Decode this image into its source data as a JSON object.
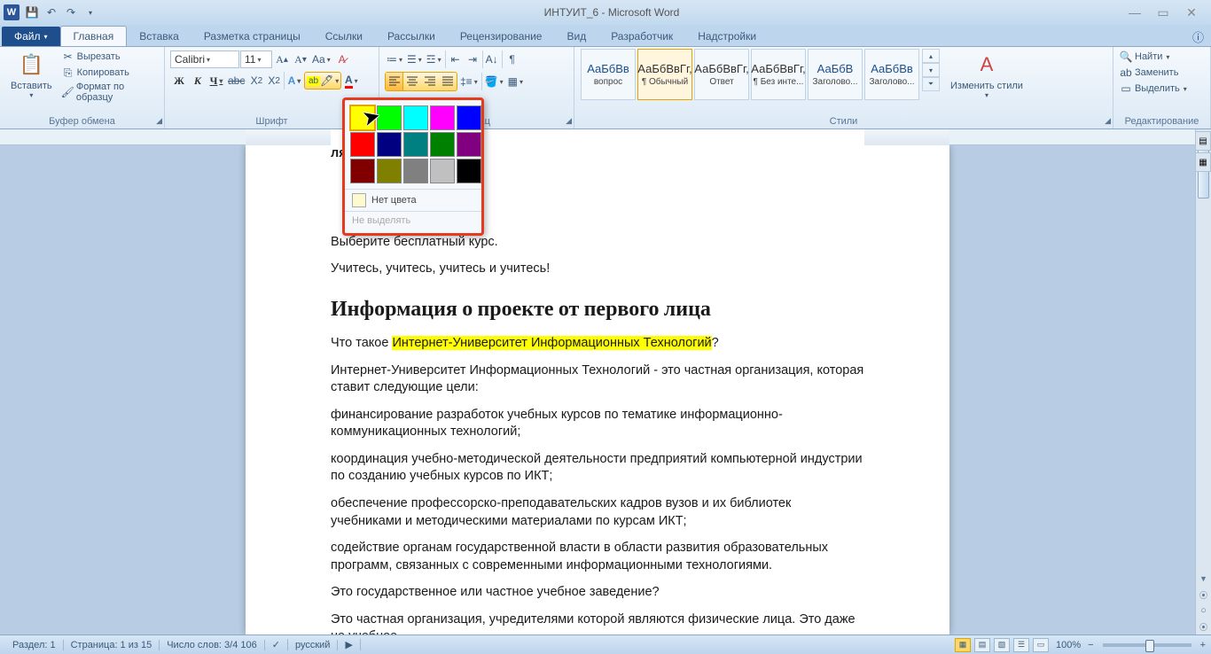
{
  "title": "ИНТУИТ_6 - Microsoft Word",
  "tabs": {
    "file": "Файл",
    "items": [
      "Главная",
      "Вставка",
      "Разметка страницы",
      "Ссылки",
      "Рассылки",
      "Рецензирование",
      "Вид",
      "Разработчик",
      "Надстройки"
    ],
    "active": 0
  },
  "clipboard": {
    "paste": "Вставить",
    "cut": "Вырезать",
    "copy": "Копировать",
    "format_painter": "Формат по образцу",
    "label": "Буфер обмена"
  },
  "font": {
    "name": "Calibri",
    "size": "11",
    "label": "Шрифт"
  },
  "paragraph": {
    "label": "Абзац"
  },
  "styles": {
    "label": "Стили",
    "change": "Изменить стили",
    "items": [
      {
        "preview": "АаБбВв",
        "label": "вопрос",
        "blue": true
      },
      {
        "preview": "АаБбВвГг,",
        "label": "¶ Обычный",
        "blue": false,
        "active": true
      },
      {
        "preview": "АаБбВвГг,",
        "label": "Ответ",
        "blue": false
      },
      {
        "preview": "АаБбВвГг,",
        "label": "¶ Без инте...",
        "blue": false
      },
      {
        "preview": "АаБбВ",
        "label": "Заголово...",
        "blue": true
      },
      {
        "preview": "АаБбВв",
        "label": "Заголово...",
        "blue": true
      }
    ]
  },
  "editing": {
    "label": "Редактирование",
    "find": "Найти",
    "replace": "Заменить",
    "select": "Выделить"
  },
  "highlight_popup": {
    "colors": [
      "#ffff00",
      "#00ff00",
      "#00ffff",
      "#ff00ff",
      "#0000ff",
      "#ff0000",
      "#000080",
      "#008080",
      "#008000",
      "#800080",
      "#800000",
      "#808000",
      "#808080",
      "#c0c0c0",
      "#000000"
    ],
    "no_color": "Нет цвета",
    "stop": "Не выделять"
  },
  "document": {
    "line1": "ля Вас комфортом.",
    "line2": "Выберите бесплатный курс.",
    "line3": "Учитесь, учитесь, учитесь и учитесь!",
    "heading": "Информация о проекте от первого лица",
    "p4a": "Что такое ",
    "p4hl": "Интернет-Университет Информационных Технологий",
    "p4b": "?",
    "p5": "Интернет-Университет Информационных Технологий - это частная организация, которая ставит следующие цели:",
    "p6": "финансирование разработок учебных курсов по тематике информационно-коммуникационных технологий;",
    "p7": "координация учебно-методической деятельности предприятий компьютерной индустрии по со­зданию учебных курсов по ИКТ;",
    "p8": "обеспечение профессорско-преподавательских кадров вузов и их библиотек учебниками и мето­дическими материалами по курсам ИКТ;",
    "p9": "содействие органам государственной власти в области развития образовательных программ, свя­занных с современными информационными технологиями.",
    "p10": "Это государственное или частное учебное заведение?",
    "p11": "Это частная организация, учредителями которой являются физические лица. Это даже не учебное"
  },
  "status": {
    "section": "Раздел: 1",
    "page": "Страница: 1 из 15",
    "words": "Число слов: 3/4 106",
    "lang": "русский",
    "zoom": "100%"
  }
}
